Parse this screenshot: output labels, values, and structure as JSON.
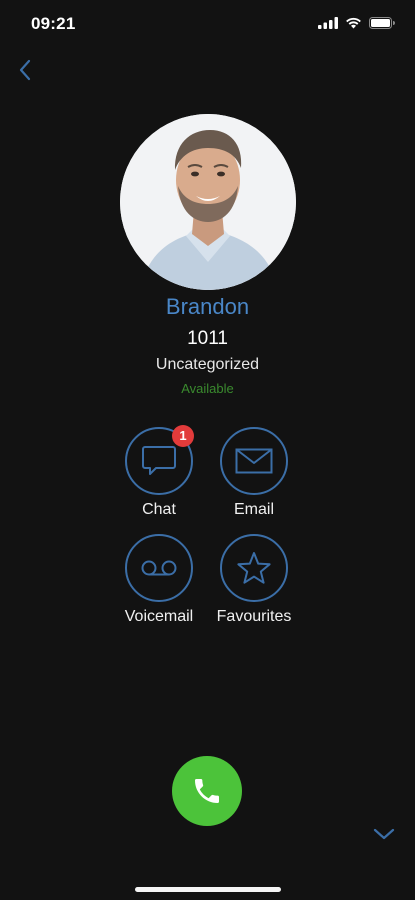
{
  "status_bar": {
    "time": "09:21"
  },
  "contact": {
    "name": "Brandon",
    "extension": "1011",
    "category": "Uncategorized",
    "presence": "Available"
  },
  "actions": {
    "chat": {
      "label": "Chat",
      "badge": "1"
    },
    "email": {
      "label": "Email"
    },
    "voicemail": {
      "label": "Voicemail"
    },
    "favourites": {
      "label": "Favourites"
    }
  },
  "colors": {
    "background": "#121212",
    "accent": "#4a87c8",
    "presence_available": "#3a8a2e",
    "call_button": "#4cc33a",
    "badge": "#e23b3b"
  },
  "icons": {
    "back": "chevron-left-icon",
    "chat": "chat-bubble-icon",
    "email": "envelope-icon",
    "voicemail": "voicemail-icon",
    "favourites": "star-icon",
    "call": "phone-icon",
    "collapse": "chevron-down-icon"
  }
}
